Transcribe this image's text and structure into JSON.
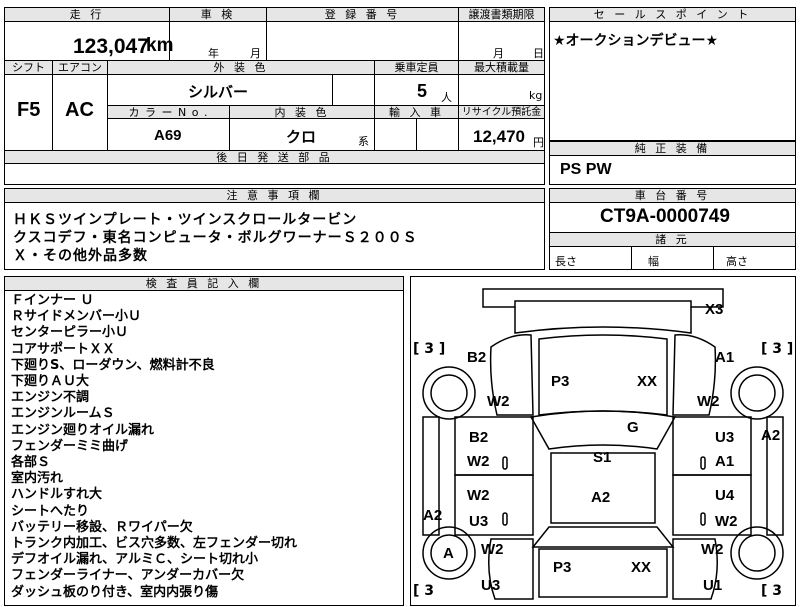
{
  "top_table": {
    "mileage_header": "走 行",
    "mileage_value": "123,047",
    "mileage_unit": "km",
    "inspection_header": "車 検",
    "inspection_year": "年",
    "inspection_month": "月",
    "registration_header": "登 録 番 号",
    "transfer_header": "譲渡書類期限",
    "transfer_month": "月",
    "transfer_day": "日",
    "shift_header": "シフト",
    "shift_value": "F5",
    "ac_header": "エアコン",
    "ac_value": "AC",
    "exterior_color_header": "外 装 色",
    "exterior_color_value": "シルバー",
    "capacity_header": "乗車定員",
    "capacity_value": "5",
    "capacity_unit": "人",
    "max_load_header": "最大積載量",
    "max_load_unit": "kg",
    "color_no_header": "カ ラ ー N o .",
    "color_no_value": "A69",
    "interior_color_header": "内 装 色",
    "interior_color_value": "クロ",
    "interior_color_suffix": "系",
    "import_header": "輸 入 車",
    "recycle_header": "リサイクル預託金",
    "recycle_value": "12,470",
    "recycle_unit": "円",
    "later_parts_header": "後 日 発 送 部 品"
  },
  "sales_point": {
    "header": "セ ー ル ス ポ イ ン ト",
    "text": "★オークションデビュー★"
  },
  "genuine_equipment": {
    "header": "純 正 装 備",
    "text": "PS PW"
  },
  "notes": {
    "header": "注 意 事 項 欄",
    "lines": [
      "ＨＫＳツインプレート・ツインスクロールタービン",
      "クスコデフ・東名コンピュータ・ボルグワーナーＳ２００Ｓ",
      "Ｘ・その他外品多数"
    ]
  },
  "chassis": {
    "header": "車 台 番 号",
    "value": "CT9A-0000749",
    "dimensions_header": "諸 元",
    "length_label": "長さ",
    "width_label": "幅",
    "height_label": "高さ"
  },
  "inspector": {
    "header": "検 査 員 記 入 欄",
    "lines": [
      "Ｆインナー Ｕ",
      "Ｒサイドメンバー小Ｕ",
      "センターピラー小Ｕ",
      "コアサポートＸＸ",
      "下廻りS、ローダウン、燃料計不良",
      "下廻りＡＵ大",
      "エンジン不調",
      "エンジンルームＳ",
      "エンジン廻りオイル漏れ",
      "フェンダーミミ曲げ",
      "各部Ｓ",
      "室内汚れ",
      "ハンドルすれ大",
      "シートへたり",
      "バッテリー移設、Ｒワイパー欠",
      "トランク内加工、ビス穴多数、左フェンダー切れ",
      "デフオイル漏れ、アルミＣ、シート切れ小",
      "フェンダーライナー、アンダーカバー欠",
      "ダッシュ板のり付き、室内内張り傷"
    ]
  },
  "diagram": {
    "marks": {
      "x3": "X3",
      "b2_top": "B2",
      "a1_top": "A1",
      "p3_top": "P3",
      "xx_top": "XX",
      "w2_left_front": "W2",
      "w2_right_front": "W2",
      "g": "G",
      "b2_mid": "B2",
      "u3_right": "U3",
      "a2_right": "A2",
      "w2_left_mid": "W2",
      "s1": "S1",
      "a1_right_mid": "A1",
      "w2_left_low": "W2",
      "a2_center": "A2",
      "u4_right": "U4",
      "a2_left": "A2",
      "u3_left": "U3",
      "w2_right_low": "W2",
      "a_wheel": "A",
      "w2_left_rear": "W2",
      "w2_right_rear": "W2",
      "p3_bottom": "P3",
      "xx_bottom": "XX",
      "u3_bottom": "U3",
      "u1_bottom": "U1"
    },
    "tire_tl": "[ 3 ]",
    "tire_tr": "[ 3 ]",
    "tire_bl": "[ 3",
    "tire_br": "[ 3"
  }
}
